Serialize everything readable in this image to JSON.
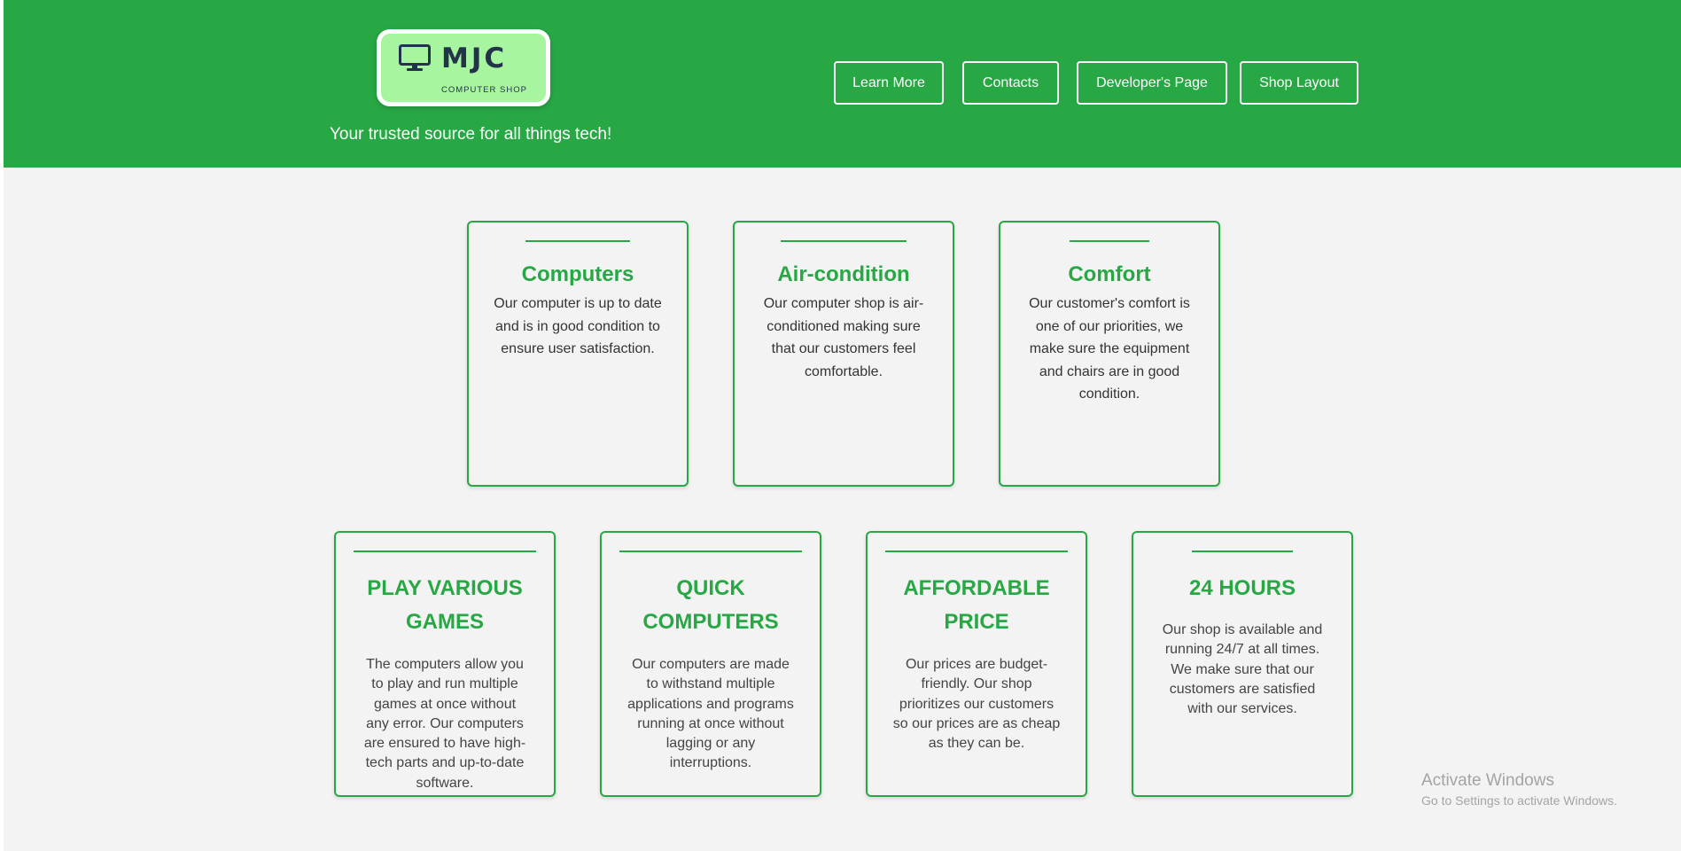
{
  "brand": {
    "name": "MJC",
    "subtitle": "COMPUTER SHOP",
    "tagline": "Your trusted source for all things tech!",
    "icon": "desktop-monitor-icon",
    "colors": {
      "header": "#28a745",
      "logo_bg": "#a8f5a0",
      "logo_text": "#23334a",
      "accent": "#28a745"
    }
  },
  "nav": {
    "learn_more": "Learn More",
    "contacts": "Contacts",
    "developers_page": "Developer's Page",
    "shop_layout": "Shop Layout"
  },
  "features_row1": [
    {
      "title": "Computers",
      "text": "Our computer is up to date and is in good condition to ensure user satisfaction."
    },
    {
      "title": "Air-condition",
      "text": "Our computer shop is air-conditioned making sure that our customers feel comfortable."
    },
    {
      "title": "Comfort",
      "text": "Our customer's comfort is one of our priorities, we make sure the equipment and chairs are in good condition."
    }
  ],
  "features_row2": [
    {
      "title": "PLAY VARIOUS GAMES",
      "text": "The computers allow you to play and run multiple games at once without any error. Our computers are ensured to have high-tech parts and up-to-date software."
    },
    {
      "title": "QUICK COMPUTERS",
      "text": "Our computers are made to withstand multiple applications and programs running at once without lagging or any interruptions."
    },
    {
      "title": "AFFORDABLE PRICE",
      "text": "Our prices are budget-friendly. Our shop prioritizes our customers so our prices are as cheap as they can be."
    },
    {
      "title": "24 HOURS",
      "text": "Our shop is available and running 24/7 at all times. We make sure that our customers are satisfied with our services."
    }
  ],
  "watermark": {
    "title": "Activate Windows",
    "subtitle": "Go to Settings to activate Windows."
  }
}
